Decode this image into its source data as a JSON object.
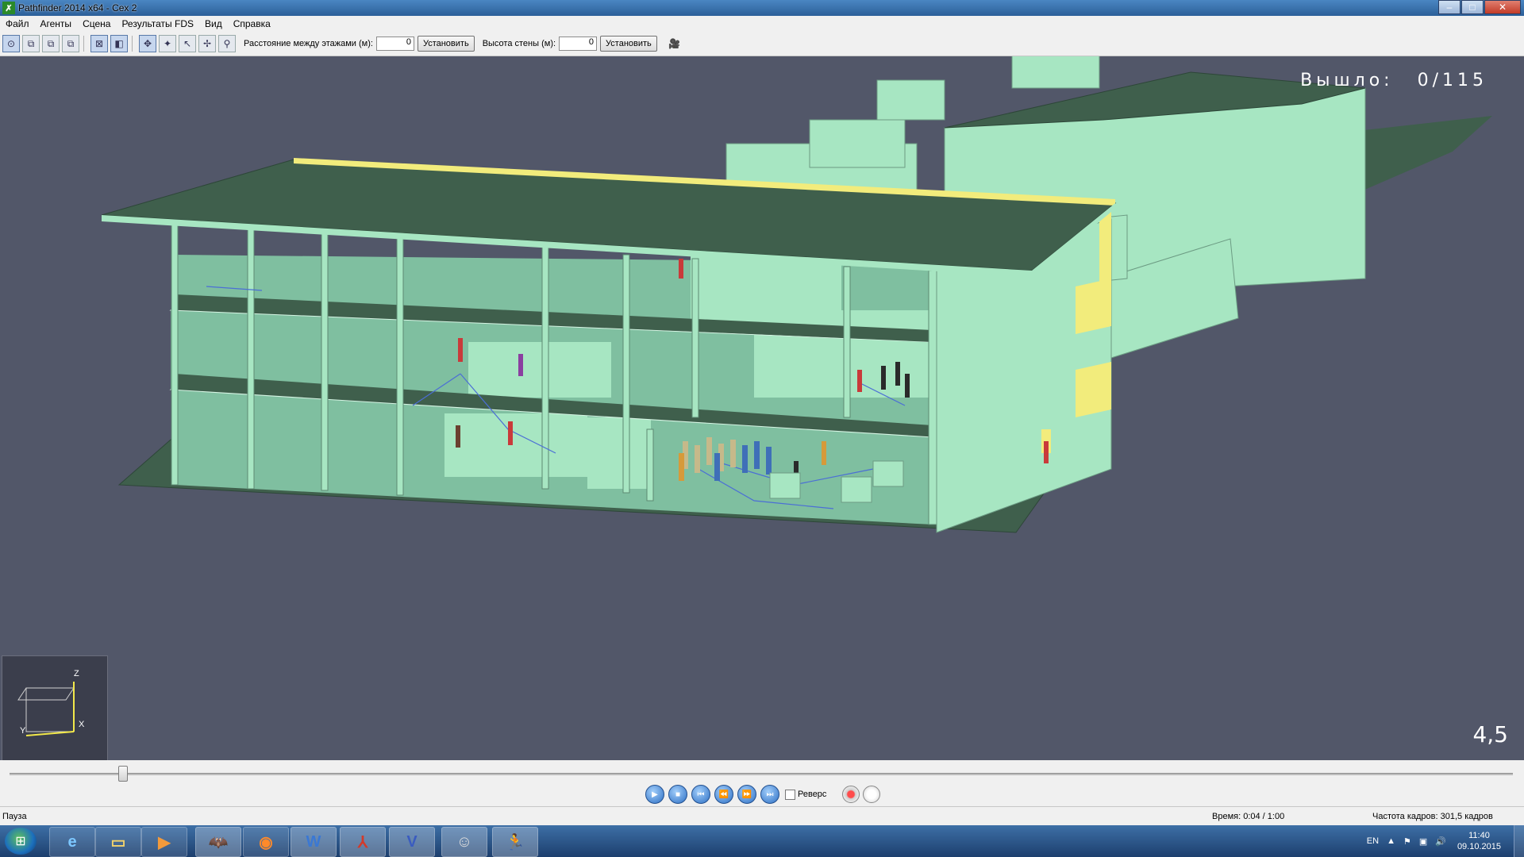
{
  "window": {
    "title": "Pathfinder 2014 x64 - Сex 2"
  },
  "menu": [
    "Файл",
    "Агенты",
    "Сцена",
    "Результаты FDS",
    "Вид",
    "Справка"
  ],
  "toolbar": {
    "floor_spacing_label": "Расстояние между этажами (м):",
    "floor_spacing_value": "0",
    "floor_spacing_button": "Установить",
    "wall_height_label": "Высота стены (м):",
    "wall_height_value": "0",
    "wall_height_button": "Установить"
  },
  "viewport": {
    "exited_label": "Вышло:",
    "exited_value": "0/115",
    "speed": "4,5",
    "axis_labels": {
      "z": "Z",
      "x": "X",
      "y": "Y"
    },
    "colors": {
      "background": "#525769",
      "walls": "#a7e6c2",
      "floors": "#3f5f4c",
      "exits": "#f2ec7c"
    }
  },
  "timeline": {
    "position_fraction": 0.075
  },
  "playback": {
    "reverse_label": "Реверс",
    "reverse_checked": false
  },
  "status": {
    "state": "Пауза",
    "time": "Время: 0:04 / 1:00",
    "fps": "Частота кадров: 301,5 кадров"
  },
  "taskbar": {
    "apps": [
      "internet-explorer",
      "file-explorer",
      "media-player",
      "batman-app",
      "firefox",
      "word",
      "pdf-reader",
      "visio",
      "app-character",
      "pathfinder"
    ],
    "language": "EN",
    "time": "11:40",
    "date": "09.10.2015"
  }
}
